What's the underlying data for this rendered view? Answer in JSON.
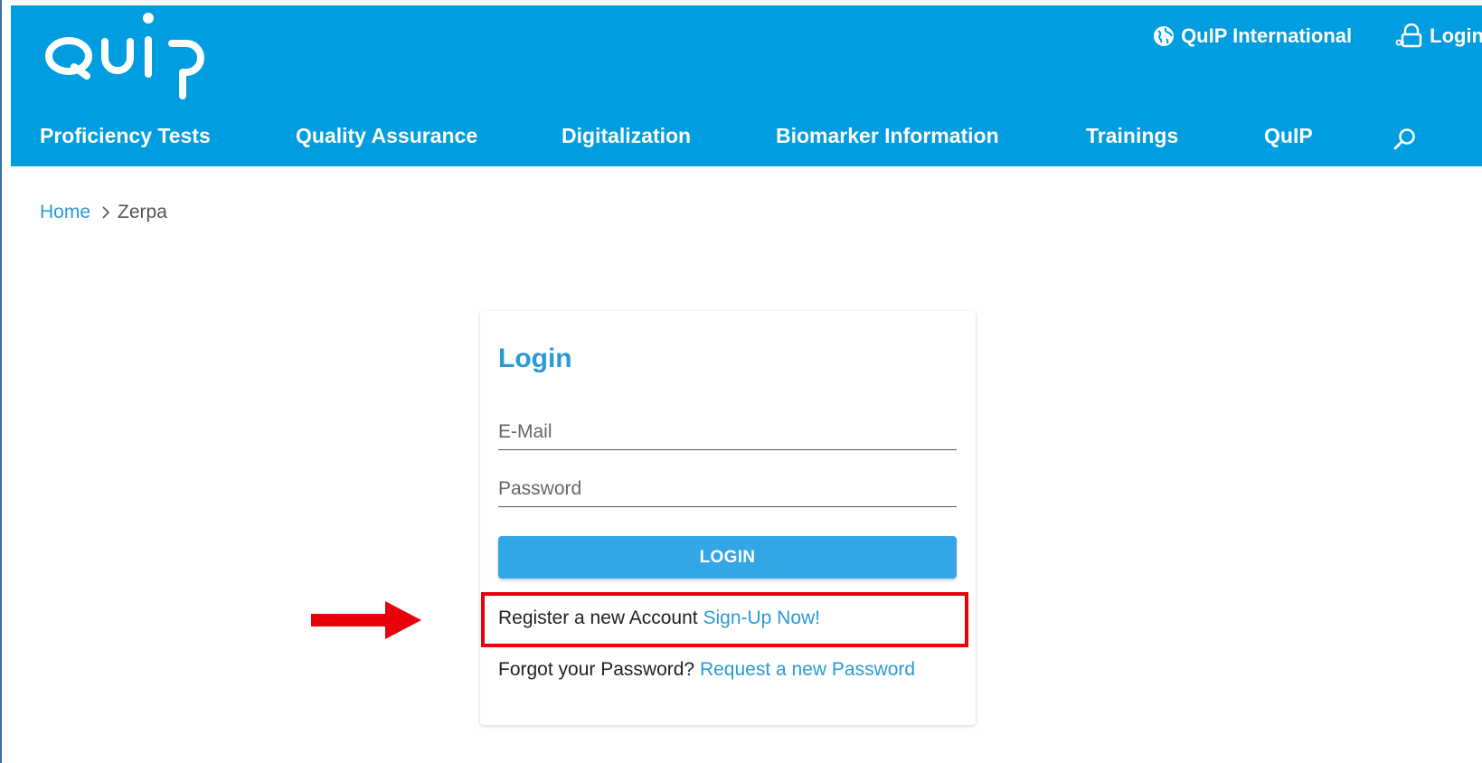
{
  "header": {
    "logo_text": "QuiP",
    "top_links": {
      "international": "QuIP International",
      "login": "Login"
    },
    "nav": [
      "Proficiency Tests",
      "Quality Assurance",
      "Digitalization",
      "Biomarker Information",
      "Trainings",
      "QuIP"
    ]
  },
  "breadcrumb": {
    "home": "Home",
    "current": "Zerpa"
  },
  "login_card": {
    "title": "Login",
    "email_placeholder": "E-Mail",
    "password_placeholder": "Password",
    "button_label": "LOGIN",
    "register_text": "Register a new Account",
    "register_link": "Sign-Up Now!",
    "forgot_text": "Forgot your Password?",
    "forgot_link": "Request a new Password"
  },
  "colors": {
    "header_bg": "#009de0",
    "link": "#2a9ad6",
    "button": "#33a6e6",
    "annotation": "#e8000b"
  },
  "icons": [
    "globe-icon",
    "lock-icon",
    "search-icon",
    "chevron-right-icon"
  ]
}
